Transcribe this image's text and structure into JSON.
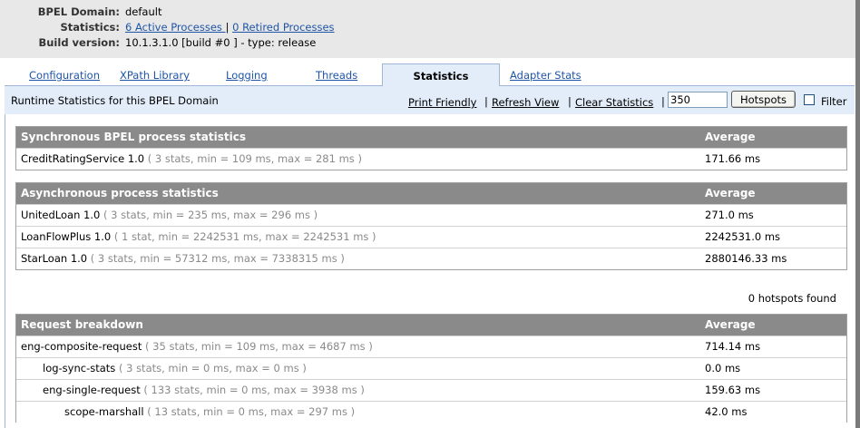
{
  "info": {
    "domain_label": "BPEL Domain:",
    "domain_value": "default",
    "statistics_label": "Statistics:",
    "active_processes": "6 Active Processes ",
    "separator": "|",
    "retired_processes": "0 Retired Processes",
    "build_label": "Build version:",
    "build_value": "10.1.3.1.0 [build #0 ] - type: release"
  },
  "tabs": [
    {
      "label": "Configuration"
    },
    {
      "label": "XPath Library"
    },
    {
      "label": "Logging"
    },
    {
      "label": "Threads"
    },
    {
      "label": "Statistics",
      "active": true
    },
    {
      "label": "Adapter Stats"
    }
  ],
  "toolbar": {
    "title": "Runtime Statistics for this BPEL Domain",
    "print_friendly": "Print Friendly",
    "refresh_view": "Refresh View",
    "clear_statistics": "Clear Statistics",
    "sep": "|",
    "hotspot_value": "350",
    "hotspots_button": "Hotspots",
    "filter_label": "Filter",
    "filter_checked": false
  },
  "sync_table": {
    "header": "Synchronous BPEL process statistics",
    "avg_header": "Average",
    "rows": [
      {
        "name": "CreditRatingService 1.0",
        "stats": "( 3 stats, min = 109 ms, max = 281 ms )",
        "avg": "171.66 ms"
      }
    ]
  },
  "async_table": {
    "header": "Asynchronous process statistics",
    "avg_header": "Average",
    "rows": [
      {
        "name": "UnitedLoan 1.0",
        "stats": "( 3 stats, min = 235 ms, max = 296 ms )",
        "avg": "271.0 ms"
      },
      {
        "name": "LoanFlowPlus 1.0",
        "stats": "( 1 stat, min = 2242531 ms, max = 2242531 ms )",
        "avg": "2242531.0 ms"
      },
      {
        "name": "StarLoan 1.0",
        "stats": "( 3 stats, min = 57312 ms, max = 7338315 ms )",
        "avg": "2880146.33 ms"
      }
    ]
  },
  "hotspots_found": "0 hotspots found",
  "request_table": {
    "header": "Request breakdown",
    "avg_header": "Average",
    "rows": [
      {
        "name": "eng-composite-request",
        "stats": "( 35 stats, min = 109 ms, max = 4687 ms )",
        "avg": "714.14 ms",
        "level": 0
      },
      {
        "name": "log-sync-stats",
        "stats": "( 3 stats, min = 0 ms, max = 0 ms )",
        "avg": "0.0 ms",
        "level": 1
      },
      {
        "name": "eng-single-request",
        "stats": "( 133 stats, min = 0 ms, max = 3938 ms )",
        "avg": "159.63 ms",
        "level": 1
      },
      {
        "name": "scope-marshall",
        "stats": "( 13 stats, min = 0 ms, max = 297 ms )",
        "avg": "42.0 ms",
        "level": 2
      }
    ]
  }
}
